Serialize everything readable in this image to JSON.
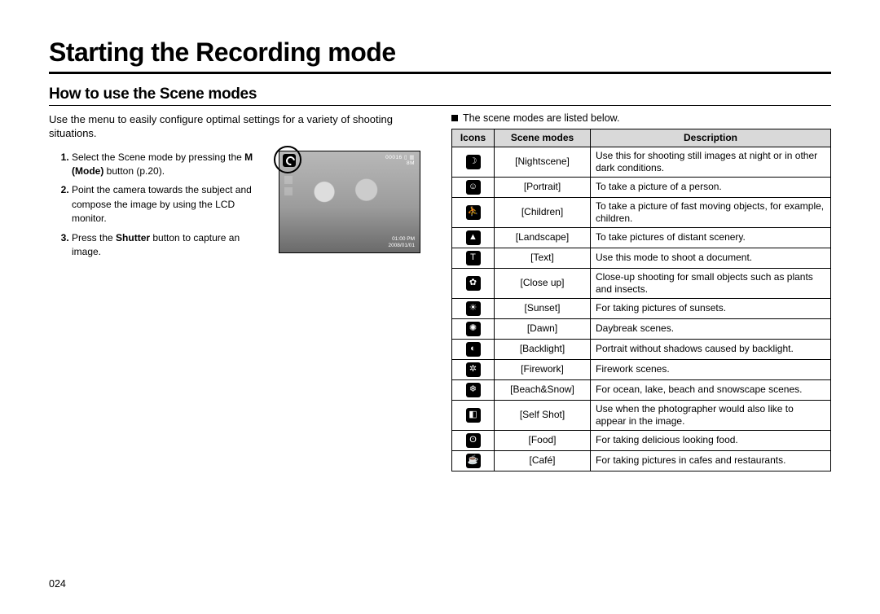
{
  "title": "Starting the Recording mode",
  "subtitle": "How to use the Scene modes",
  "intro": "Use the menu to easily configure optimal settings for a variety of shooting situations.",
  "steps": {
    "s1a": "Select the Scene mode by pressing the ",
    "s1b": "M (Mode)",
    "s1c": " button (p.20).",
    "s2": "Point the camera towards the subject and compose the image by using the LCD monitor.",
    "s3a": "Press the ",
    "s3b": "Shutter",
    "s3c": " button to capture an image."
  },
  "lcd": {
    "counter": "00016 ▯ ▥",
    "res": "8M",
    "time": "01:00 PM",
    "date": "2008/01/01"
  },
  "lead": "The scene modes are listed below.",
  "headers": {
    "icons": "Icons",
    "modes": "Scene modes",
    "desc": "Description"
  },
  "rows": [
    {
      "glyph": "☽",
      "name": "[Nightscene]",
      "desc": "Use this for shooting still images at night or in other dark conditions."
    },
    {
      "glyph": "☺",
      "name": "[Portrait]",
      "desc": "To take a picture of a person."
    },
    {
      "glyph": "⛹",
      "name": "[Children]",
      "desc": "To take a picture of fast moving objects, for example, children."
    },
    {
      "glyph": "▲",
      "name": "[Landscape]",
      "desc": "To take pictures of distant scenery."
    },
    {
      "glyph": "T",
      "name": "[Text]",
      "desc": "Use this mode to shoot a document."
    },
    {
      "glyph": "✿",
      "name": "[Close up]",
      "desc": "Close-up shooting for small objects such as plants and insects."
    },
    {
      "glyph": "☀",
      "name": "[Sunset]",
      "desc": "For taking pictures of sunsets."
    },
    {
      "glyph": "✺",
      "name": "[Dawn]",
      "desc": "Daybreak scenes."
    },
    {
      "glyph": "◐",
      "name": "[Backlight]",
      "desc": "Portrait without shadows caused by backlight."
    },
    {
      "glyph": "✲",
      "name": "[Firework]",
      "desc": "Firework scenes."
    },
    {
      "glyph": "❄",
      "name": "[Beach&Snow]",
      "desc": "For ocean, lake, beach and snowscape scenes."
    },
    {
      "glyph": "◧",
      "name": "[Self Shot]",
      "desc": "Use when the photographer would also like to appear in the image."
    },
    {
      "glyph": "ʘ",
      "name": "[Food]",
      "desc": "For taking delicious looking food."
    },
    {
      "glyph": "☕",
      "name": "[Café]",
      "desc": "For taking pictures in cafes and restaurants."
    }
  ],
  "page_number": "024"
}
